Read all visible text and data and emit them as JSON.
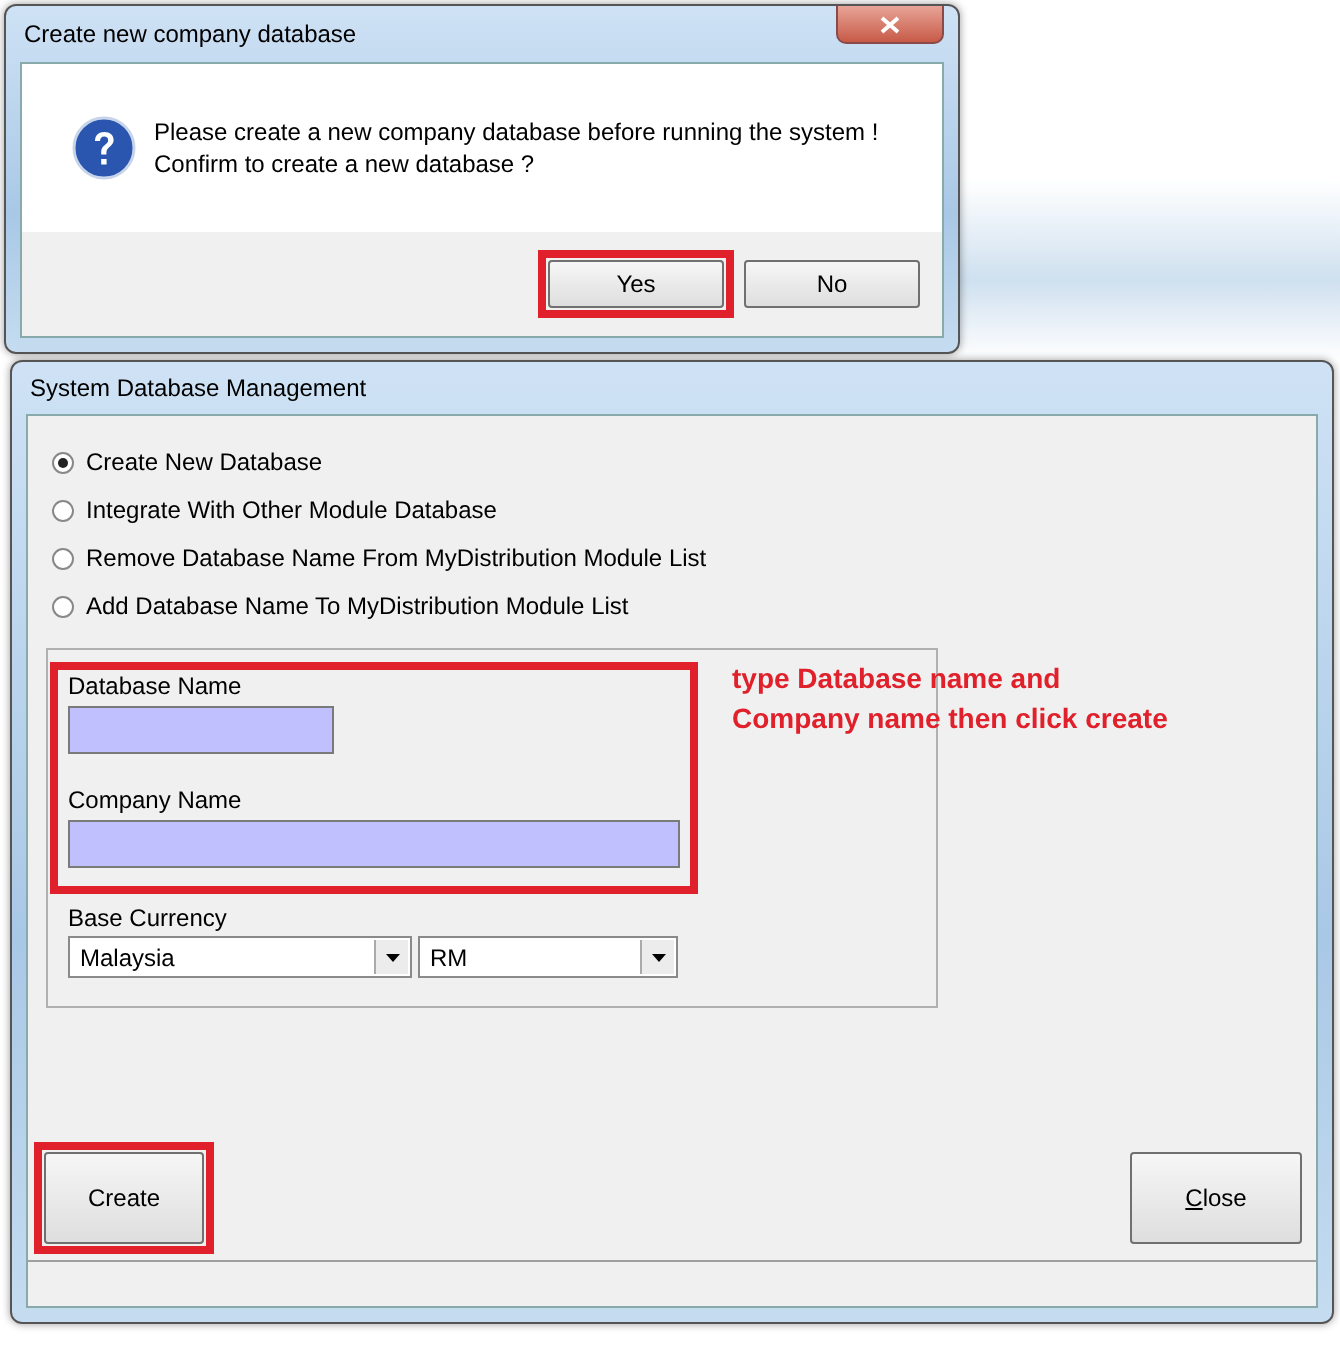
{
  "confirm_dialog": {
    "title": "Create new company database",
    "message_lines": [
      "Please create a new company database before running the system !",
      "Confirm to create a new database ?"
    ],
    "buttons": [
      {
        "label": "Yes",
        "highlighted": true
      },
      {
        "label": "No",
        "highlighted": false
      }
    ]
  },
  "main_window": {
    "title": "System Database Management",
    "options": [
      {
        "label": "Create New Database",
        "selected": true
      },
      {
        "label": "Integrate With Other Module Database",
        "selected": false
      },
      {
        "label": "Remove Database Name From MyDistribution Module List",
        "selected": false
      },
      {
        "label": "Add Database Name To MyDistribution Module List",
        "selected": false
      }
    ],
    "fields": [
      {
        "label": "Database Name"
      },
      {
        "label": "Company Name"
      }
    ],
    "fields_highlighted": true,
    "base_currency": {
      "label": "Base Currency",
      "country": "Malaysia",
      "currency": "RM"
    },
    "annotation": "type Database name and\nCompany name then click create",
    "buttons": [
      {
        "label": "Create",
        "highlighted": true,
        "underline_first": false
      },
      {
        "label": "Close",
        "highlighted": false,
        "underline_first": true
      }
    ]
  }
}
